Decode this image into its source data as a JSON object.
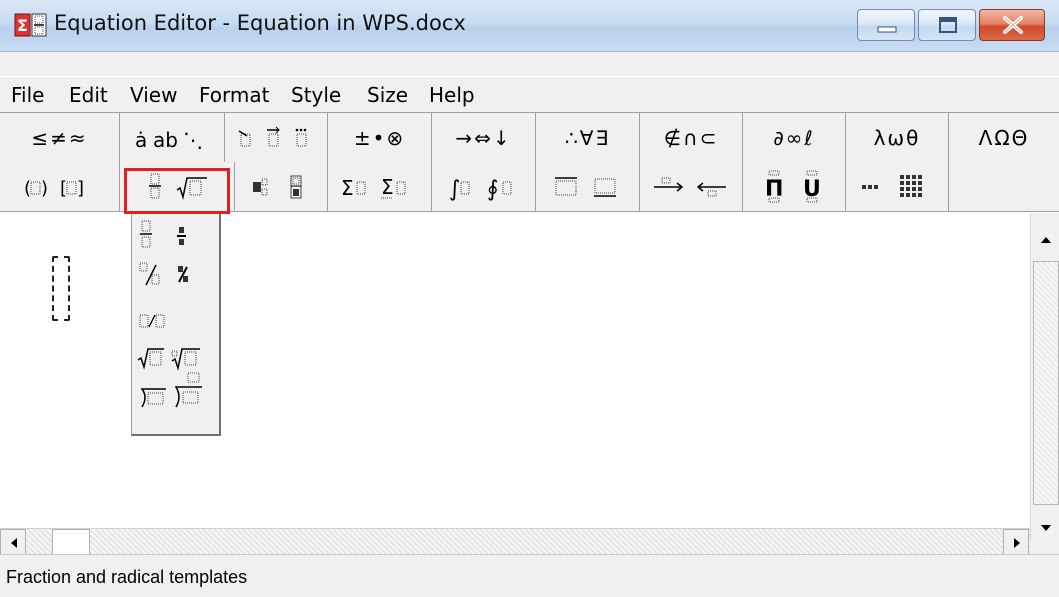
{
  "window": {
    "title": "Equation Editor - Equation in WPS.docx",
    "app_icon": "equation-editor-icon"
  },
  "menu": {
    "items": [
      "File",
      "Edit",
      "View",
      "Format",
      "Style",
      "Size",
      "Help"
    ]
  },
  "palettes": {
    "row1": [
      {
        "name": "relational-symbols",
        "glyphs": "≤≠≈"
      },
      {
        "name": "spaces-and-ellipses",
        "glyphs": "⸱ab⋱"
      },
      {
        "name": "embellishments",
        "glyphs": "embellishment-icons"
      },
      {
        "name": "operator-symbols",
        "glyphs": "±•⊗"
      },
      {
        "name": "arrow-symbols",
        "glyphs": "→⇔↓"
      },
      {
        "name": "logical-symbols",
        "glyphs": "∴∀∃"
      },
      {
        "name": "set-theory-symbols",
        "glyphs": "∉∩⊂"
      },
      {
        "name": "miscellaneous-symbols",
        "glyphs": "∂∞ℓ"
      },
      {
        "name": "greek-lowercase",
        "glyphs": "λωθ"
      },
      {
        "name": "greek-uppercase",
        "glyphs": "ΛΩΘ"
      }
    ],
    "row2": [
      {
        "name": "fence-templates",
        "icon": "parentheses-templates-icon"
      },
      {
        "name": "fraction-radical-templates",
        "icon": "fraction-radical-icon",
        "selected": true
      },
      {
        "name": "subscript-superscript-templates",
        "icon": "subscript-superscript-icon"
      },
      {
        "name": "summation-templates",
        "icon": "summation-icon"
      },
      {
        "name": "integral-templates",
        "icon": "integral-icon"
      },
      {
        "name": "underbar-overbar-templates",
        "icon": "overbar-underbar-icon"
      },
      {
        "name": "labeled-arrow-templates",
        "icon": "labeled-arrow-icon"
      },
      {
        "name": "products-set-theory-templates",
        "icon": "product-coproduct-icon"
      },
      {
        "name": "matrix-templates",
        "icon": "matrix-icon"
      }
    ]
  },
  "dropdown": {
    "items": [
      "full-size-fraction-icon",
      "small-fraction-icon",
      "slash-fraction-icon",
      "small-slash-fraction-icon",
      "baseline-slash-fraction-icon",
      "square-root-icon",
      "nth-root-icon",
      "long-division-icon",
      "long-division-with-quotient-icon"
    ]
  },
  "status": {
    "text": "Fraction and radical templates"
  }
}
